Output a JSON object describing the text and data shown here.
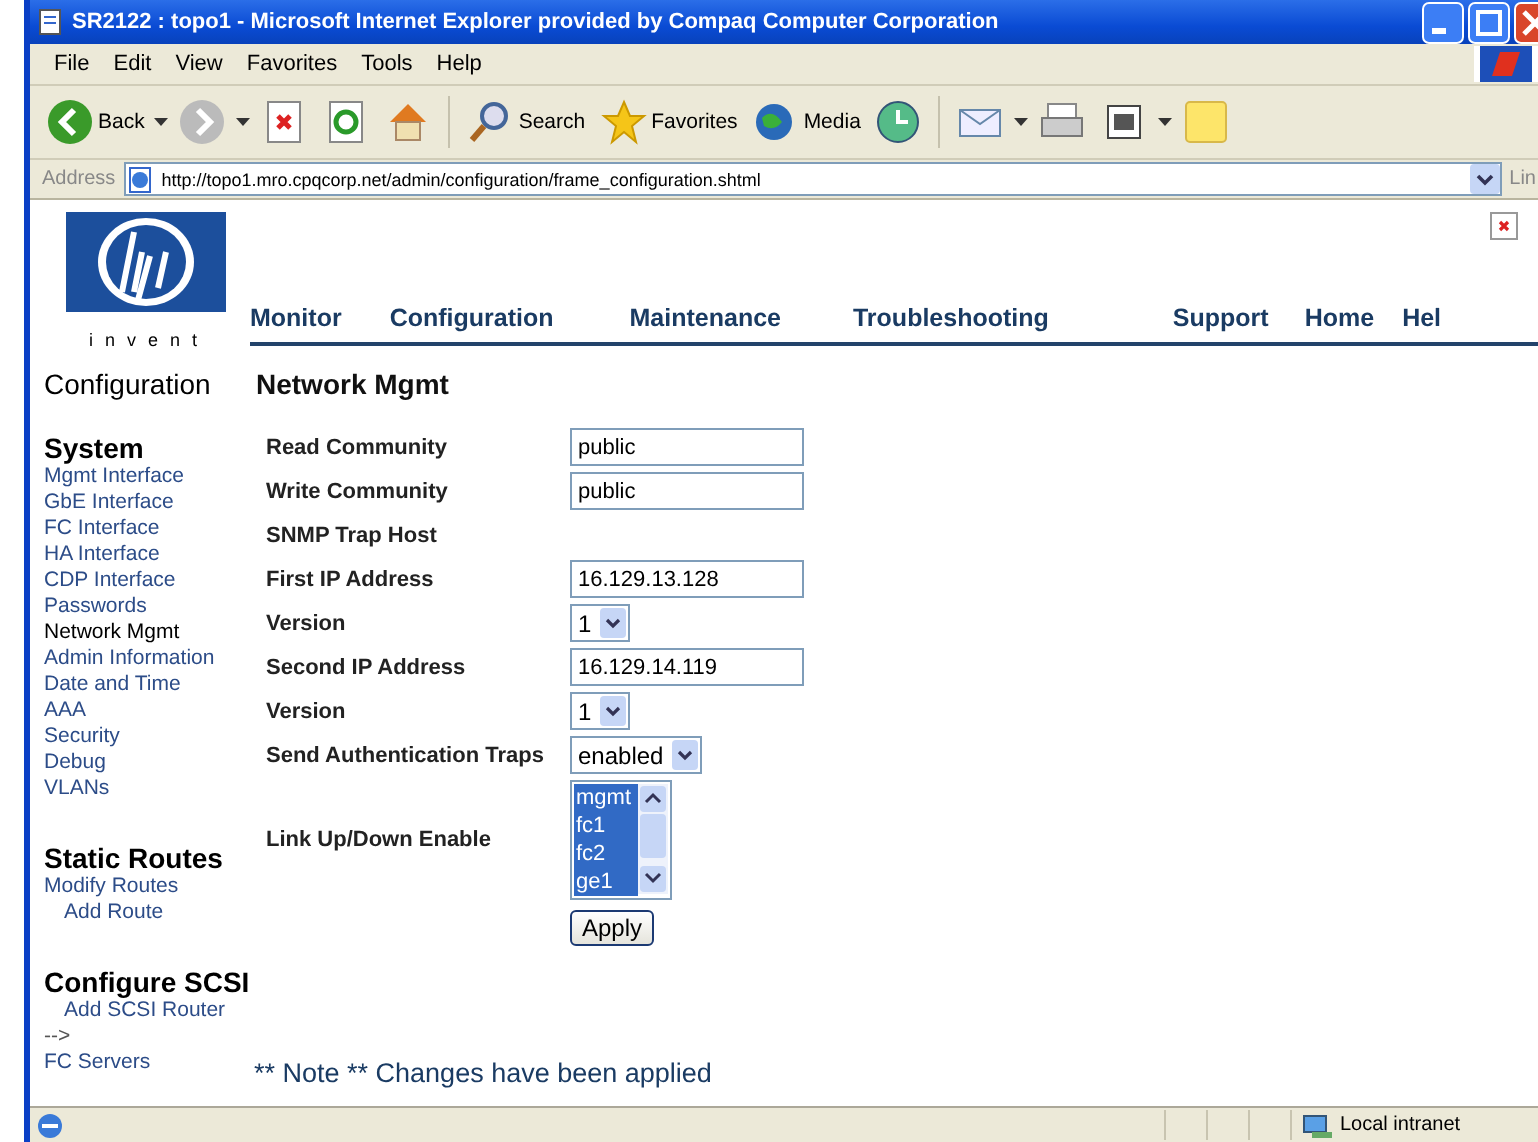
{
  "window": {
    "title": "SR2122 : topo1 - Microsoft Internet Explorer provided by Compaq Computer Corporation"
  },
  "menu": [
    "File",
    "Edit",
    "View",
    "Favorites",
    "Tools",
    "Help"
  ],
  "toolbar": [
    {
      "kind": "back",
      "label": "Back"
    },
    {
      "kind": "forward"
    },
    {
      "kind": "stop"
    },
    {
      "kind": "refresh"
    },
    {
      "kind": "home"
    },
    {
      "kind": "search",
      "label": "Search"
    },
    {
      "kind": "favorites",
      "label": "Favorites"
    },
    {
      "kind": "media",
      "label": "Media"
    },
    {
      "kind": "history"
    },
    {
      "kind": "mail"
    },
    {
      "kind": "print"
    },
    {
      "kind": "edit"
    },
    {
      "kind": "note"
    }
  ],
  "address": {
    "label": "Address",
    "url": "http://topo1.mro.cpqcorp.net/admin/configuration/frame_configuration.shtml",
    "links": "Lin"
  },
  "page": {
    "logo_text": "invent",
    "nav": [
      "Monitor",
      "Configuration",
      "Maintenance",
      "Troubleshooting",
      "Support",
      "Home",
      "Hel"
    ],
    "sidebar_title": "Configuration",
    "heading": "Network Mgmt",
    "sidebar": [
      {
        "title": "System",
        "items": [
          {
            "label": "Mgmt Interface",
            "selected": false
          },
          {
            "label": "GbE Interface",
            "selected": false
          },
          {
            "label": "FC Interface",
            "selected": false
          },
          {
            "label": "HA Interface",
            "selected": false
          },
          {
            "label": "CDP Interface",
            "selected": false
          },
          {
            "label": "Passwords",
            "selected": false
          },
          {
            "label": "Network Mgmt",
            "selected": true
          },
          {
            "label": "Admin Information",
            "selected": false
          },
          {
            "label": "Date and Time",
            "selected": false
          },
          {
            "label": "AAA",
            "selected": false
          },
          {
            "label": "Security",
            "selected": false
          },
          {
            "label": "Debug",
            "selected": false
          },
          {
            "label": "VLANs",
            "selected": false
          }
        ]
      },
      {
        "title": "Static Routes",
        "items": [
          {
            "label": "Modify Routes",
            "selected": false,
            "children": [
              {
                "label": "Add Route",
                "selected": false
              }
            ]
          }
        ]
      },
      {
        "title": "Configure SCSI",
        "items": [
          {
            "label": "Add SCSI Router",
            "selected": false,
            "indent": true
          },
          {
            "label": "-->",
            "kind": "text"
          },
          {
            "label": "FC Servers",
            "selected": false
          }
        ]
      }
    ],
    "form": [
      {
        "kind": "field",
        "label": "Read Community",
        "value": "public"
      },
      {
        "kind": "field",
        "label": "Write Community",
        "value": "public"
      },
      {
        "kind": "heading",
        "label": "SNMP Trap Host"
      },
      {
        "kind": "field",
        "label": "First IP Address",
        "value": "16.129.13.128"
      },
      {
        "kind": "select",
        "label": "Version",
        "value": "1"
      },
      {
        "kind": "field",
        "label": "Second IP Address",
        "value": "16.129.14.119"
      },
      {
        "kind": "select",
        "label": "Version",
        "value": "1"
      },
      {
        "kind": "select",
        "label": "Send Authentication Traps",
        "value": "enabled"
      },
      {
        "kind": "listbox",
        "label": "Link Up/Down Enable",
        "options": [
          {
            "label": "mgmt",
            "selected": true
          },
          {
            "label": "fc1",
            "selected": true
          },
          {
            "label": "fc2",
            "selected": true
          },
          {
            "label": "ge1",
            "selected": true
          }
        ]
      }
    ],
    "apply": "Apply",
    "note": "** Note ** Changes have been applied"
  },
  "status_bar": {
    "zone": "Local intranet"
  }
}
